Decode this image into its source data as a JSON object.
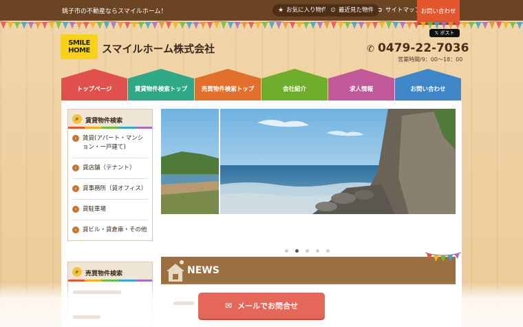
{
  "topbar": {
    "tagline": "銚子市の不動産ならスマイルホーム！",
    "favorites_label": "お気に入り物件",
    "recent_label": "最近見た物件",
    "sitemap_label": "サイトマップ",
    "contact_label": "お問い合わせ"
  },
  "header": {
    "logo_line1": "SMILE",
    "logo_line2": "HOME",
    "company_name": "スマイルホーム株式会社",
    "post_label": "ポスト",
    "phone": "0479-22-7036",
    "hours": "営業時間/9：00〜18：00"
  },
  "nav": {
    "items": [
      {
        "label": "トップページ",
        "color": "#e0514e"
      },
      {
        "label": "賃貸物件検索トップ",
        "color": "#2fa886"
      },
      {
        "label": "売買物件検索トップ",
        "color": "#e2702c"
      },
      {
        "label": "会社紹介",
        "color": "#6fae2c"
      },
      {
        "label": "求人情報",
        "color": "#c0589a"
      },
      {
        "label": "お問い合わせ",
        "color": "#3e86c8"
      }
    ]
  },
  "sidebar": {
    "rental": {
      "title": "賃貸物件検索",
      "items": [
        "賃貸(アパート・マンション・一戸建て)",
        "貸店舗（テナント）",
        "貸事務所（貸オフィス）",
        "貸駐車場",
        "貸ビル・貸倉庫・その他"
      ]
    },
    "sale": {
      "title": "売買物件検索"
    }
  },
  "slider": {
    "total": 5,
    "active_index": 1
  },
  "news": {
    "title": "NEWS"
  },
  "cta": {
    "mail_label": "メールでお問合せ"
  }
}
